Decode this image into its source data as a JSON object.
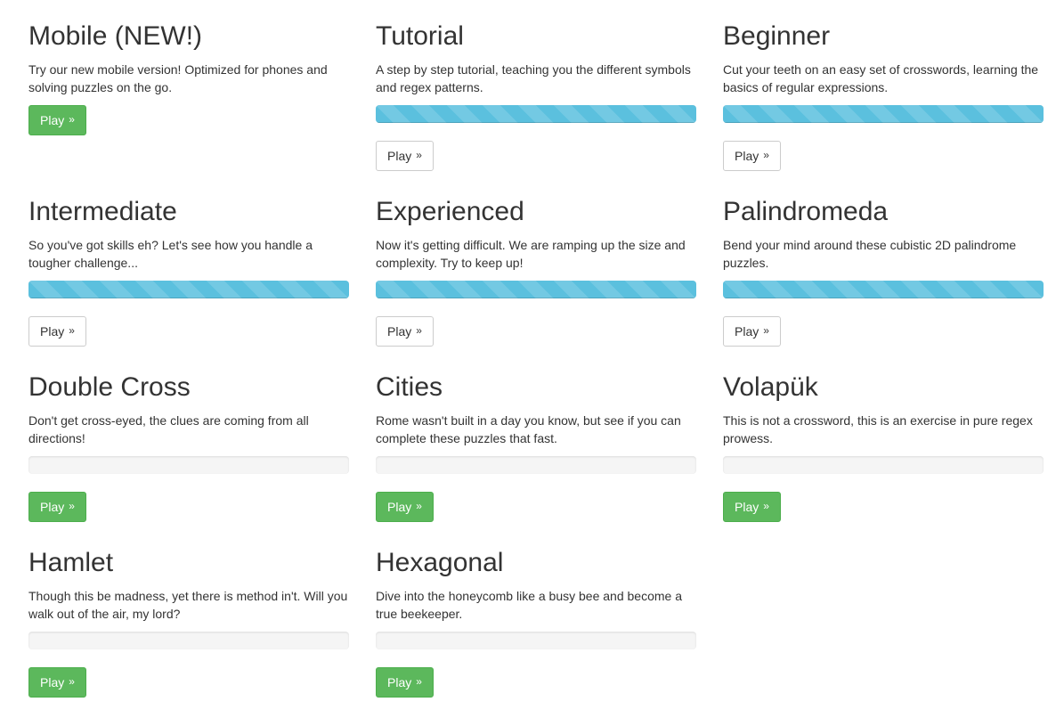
{
  "puzzles": [
    {
      "title": "Mobile (NEW!)",
      "description": "Try our new mobile version! Optimized for phones and solving puzzles on the go.",
      "progress": null,
      "button_label": "Play",
      "button_style": "success",
      "button_glyph": "»"
    },
    {
      "title": "Tutorial",
      "description": "A step by step tutorial, teaching you the different symbols and regex patterns.",
      "progress": 1.0,
      "button_label": "Play",
      "button_style": "default",
      "button_glyph": "»"
    },
    {
      "title": "Beginner",
      "description": "Cut your teeth on an easy set of crosswords, learning the basics of regular expressions.",
      "progress": 1.0,
      "button_label": "Play",
      "button_style": "default",
      "button_glyph": "»"
    },
    {
      "title": "Intermediate",
      "description": "So you've got skills eh? Let's see how you handle a tougher challenge...",
      "progress": 1.0,
      "button_label": "Play",
      "button_style": "default",
      "button_glyph": "»"
    },
    {
      "title": "Experienced",
      "description": "Now it's getting difficult. We are ramping up the size and complexity. Try to keep up!",
      "progress": 1.0,
      "button_label": "Play",
      "button_style": "default",
      "button_glyph": "»"
    },
    {
      "title": "Palindromeda",
      "description": "Bend your mind around these cubistic 2D palindrome puzzles.",
      "progress": 1.0,
      "button_label": "Play",
      "button_style": "default",
      "button_glyph": "»"
    },
    {
      "title": "Double Cross",
      "description": "Don't get cross-eyed, the clues are coming from all directions!",
      "progress": 0.0,
      "button_label": "Play",
      "button_style": "success",
      "button_glyph": "»"
    },
    {
      "title": "Cities",
      "description": "Rome wasn't built in a day you know, but see if you can complete these puzzles that fast.",
      "progress": 0.0,
      "button_label": "Play",
      "button_style": "success",
      "button_glyph": "»"
    },
    {
      "title": "Volapük",
      "description": "This is not a crossword, this is an exercise in pure regex prowess.",
      "progress": 0.0,
      "button_label": "Play",
      "button_style": "success",
      "button_glyph": "»"
    },
    {
      "title": "Hamlet",
      "description": "Though this be madness, yet there is method in't. Will you walk out of the air, my lord?",
      "progress": 0.0,
      "button_label": "Play",
      "button_style": "success",
      "button_glyph": "»"
    },
    {
      "title": "Hexagonal",
      "description": "Dive into the honeycomb like a busy bee and become a true beekeeper.",
      "progress": 0.0,
      "button_label": "Play",
      "button_style": "success",
      "button_glyph": "»"
    }
  ],
  "colors": {
    "progress_fill": "#5bc0de",
    "success_button": "#5cb85c",
    "default_button": "#ffffff"
  }
}
